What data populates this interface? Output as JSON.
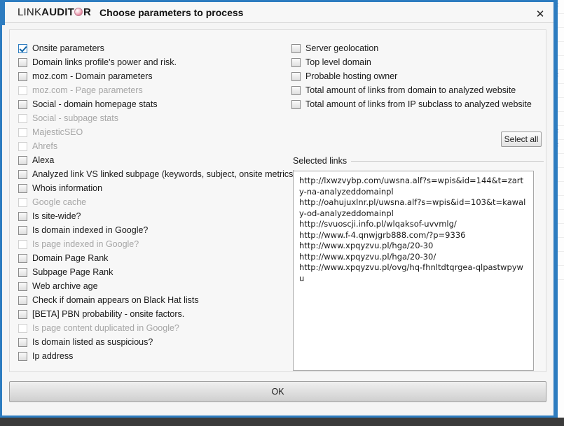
{
  "window": {
    "logo_light": "LINK ",
    "logo_bold_pre": "AUDIT",
    "logo_globe_letter": "O",
    "logo_bold_post": "R",
    "subtitle": "Choose parameters to process",
    "close_icon": "close-icon",
    "close_glyph": "✕"
  },
  "colors": {
    "accent_blue": "#2d7cc0",
    "check_blue": "#1467a8",
    "dialog_bg": "#f5f5f5",
    "panel_bg": "#f7f7f7",
    "disabled_text": "#a6a6a6",
    "logo_globe": "#e8879f"
  },
  "left_column": [
    {
      "label": "Onsite parameters",
      "checked": true,
      "enabled": true
    },
    {
      "label": "Domain links profile's power and risk.",
      "checked": false,
      "enabled": true
    },
    {
      "label": "moz.com - Domain parameters",
      "checked": false,
      "enabled": true
    },
    {
      "label": "moz.com - Page parameters",
      "checked": false,
      "enabled": false
    },
    {
      "label": "Social - domain homepage stats",
      "checked": false,
      "enabled": true
    },
    {
      "label": "Social - subpage stats",
      "checked": false,
      "enabled": false
    },
    {
      "label": "MajesticSEO",
      "checked": false,
      "enabled": false
    },
    {
      "label": "Ahrefs",
      "checked": false,
      "enabled": false
    },
    {
      "label": "Alexa",
      "checked": false,
      "enabled": true
    },
    {
      "label": "Analyzed link VS linked subpage (keywords, subject, onsite metrics)",
      "checked": false,
      "enabled": true
    },
    {
      "label": "Whois information",
      "checked": false,
      "enabled": true
    },
    {
      "label": "Google cache",
      "checked": false,
      "enabled": false
    },
    {
      "label": "Is site-wide?",
      "checked": false,
      "enabled": true
    },
    {
      "label": "Is domain indexed in Google?",
      "checked": false,
      "enabled": true
    },
    {
      "label": "Is page indexed in Google?",
      "checked": false,
      "enabled": false
    },
    {
      "label": "Domain Page Rank",
      "checked": false,
      "enabled": true
    },
    {
      "label": "Subpage Page Rank",
      "checked": false,
      "enabled": true
    },
    {
      "label": "Web archive age",
      "checked": false,
      "enabled": true
    },
    {
      "label": "Check if domain appears on Black Hat lists",
      "checked": false,
      "enabled": true
    },
    {
      "label": "[BETA] PBN probability - onsite factors.",
      "checked": false,
      "enabled": true
    },
    {
      "label": "Is page content duplicated in Google?",
      "checked": false,
      "enabled": false
    },
    {
      "label": "Is domain listed as suspicious?",
      "checked": false,
      "enabled": true
    },
    {
      "label": "Ip address",
      "checked": false,
      "enabled": true
    }
  ],
  "right_column": [
    {
      "label": "Server geolocation",
      "checked": false,
      "enabled": true
    },
    {
      "label": "Top level domain",
      "checked": false,
      "enabled": true
    },
    {
      "label": "Probable hosting owner",
      "checked": false,
      "enabled": true
    },
    {
      "label": "Total amount of links from domain to analyzed website",
      "checked": false,
      "enabled": true
    },
    {
      "label": "Total amount of links from IP subclass to analyzed website",
      "checked": false,
      "enabled": true
    }
  ],
  "select_all_label": "Select all",
  "links_group": {
    "title": "Selected links",
    "urls": [
      "http://lxwzvybp.com/uwsna.alf?s=wpis&id=144&t=zarty-na-analyzeddomainpl",
      "http://oahujuxlnr.pl/uwsna.alf?s=wpis&id=103&t=kawaly-od-analyzeddomainpl",
      "http://svuoscji.info.pl/wlqaksof-uvvmlg/",
      "http://www.f-4.qnwjgrb888.com/?p=9336",
      "http://www.xpqyzvu.pl/hga/20-30",
      "http://www.xpqyzvu.pl/hga/20-30/",
      "http://www.xpqyzvu.pl/ovg/hq-fhnltdtqrgea-qlpastwpywu"
    ]
  },
  "ok_label": "OK"
}
